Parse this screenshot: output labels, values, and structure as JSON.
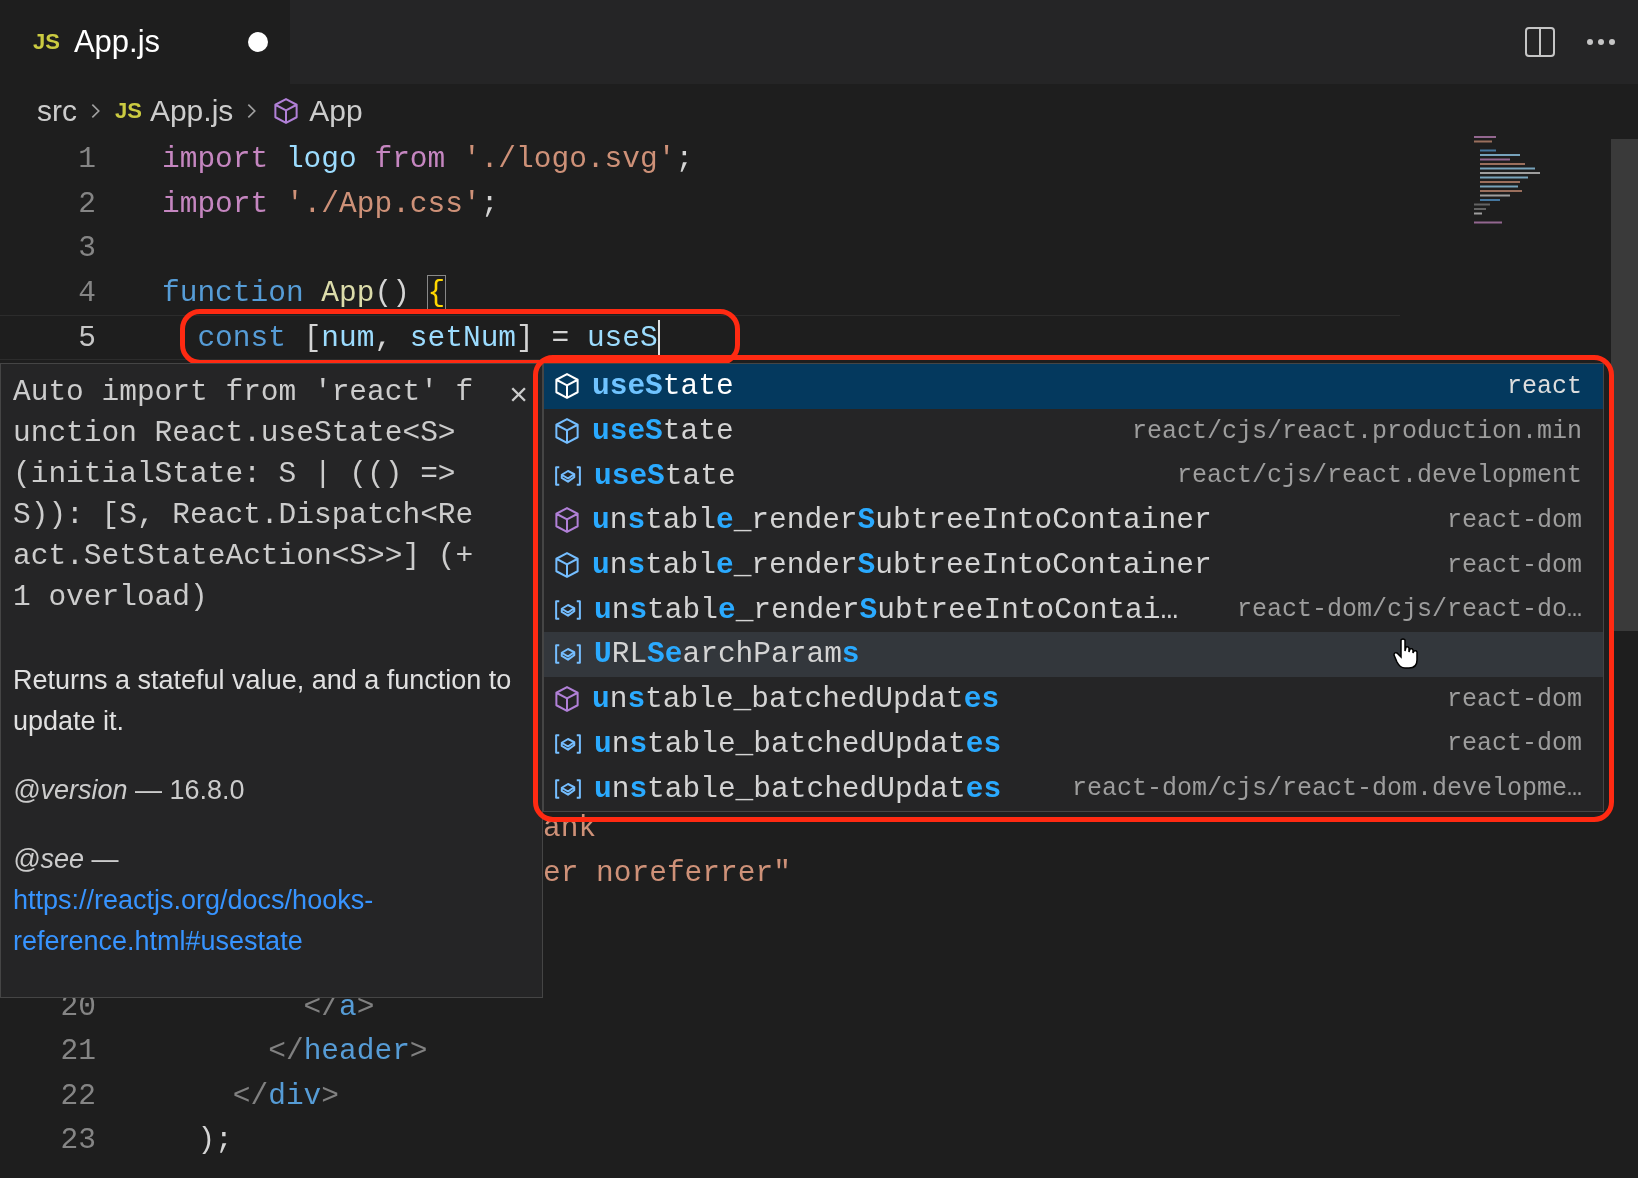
{
  "tab": {
    "icon_label": "JS",
    "title": "App.js",
    "modified": true
  },
  "breadcrumb": [
    {
      "kind": "folder",
      "label": "src"
    },
    {
      "kind": "file",
      "icon_label": "JS",
      "label": "App.js"
    },
    {
      "kind": "symbol",
      "label": "App"
    }
  ],
  "code_top": [
    {
      "number": "1",
      "current": false,
      "caret": false,
      "tokens": [
        {
          "text": "import ",
          "kind": "keyword"
        },
        {
          "text": "logo ",
          "kind": "variable"
        },
        {
          "text": "from ",
          "kind": "keyword"
        },
        {
          "text": "'./logo.svg'",
          "kind": "string"
        },
        {
          "text": ";",
          "kind": "plain"
        }
      ]
    },
    {
      "number": "2",
      "current": false,
      "caret": false,
      "tokens": [
        {
          "text": "import ",
          "kind": "keyword"
        },
        {
          "text": "'./App.css'",
          "kind": "string"
        },
        {
          "text": ";",
          "kind": "plain"
        }
      ]
    },
    {
      "number": "3",
      "current": false,
      "caret": false
    },
    {
      "number": "4",
      "current": false,
      "caret": false,
      "tokens": [
        {
          "text": "function ",
          "kind": "storage"
        },
        {
          "text": "App",
          "kind": "func"
        },
        {
          "text": "() ",
          "kind": "plain"
        },
        {
          "text": "{",
          "kind": "bracket_match"
        }
      ]
    },
    {
      "number": "5",
      "current": true,
      "caret": true,
      "tokens": [
        {
          "text": "  const ",
          "kind": "storage"
        },
        {
          "text": "[",
          "kind": "plain"
        },
        {
          "text": "num",
          "kind": "variable"
        },
        {
          "text": ", ",
          "kind": "plain"
        },
        {
          "text": "setNum",
          "kind": "variable"
        },
        {
          "text": "] = ",
          "kind": "plain"
        },
        {
          "text": "useS",
          "kind": "variable"
        }
      ]
    }
  ],
  "code_fragments": [
    {
      "text": "ank",
      "kind": "string"
    },
    {
      "text": "er noreferrer\"",
      "kind": "string"
    }
  ],
  "code_bottom": [
    {
      "number": "20",
      "current": false,
      "caret": false,
      "tokens": [
        {
          "text": "        </",
          "kind": "punct"
        },
        {
          "text": "a",
          "kind": "tag"
        },
        {
          "text": ">",
          "kind": "punct"
        }
      ]
    },
    {
      "number": "21",
      "current": false,
      "caret": false,
      "tokens": [
        {
          "text": "      </",
          "kind": "punct"
        },
        {
          "text": "header",
          "kind": "tag"
        },
        {
          "text": ">",
          "kind": "punct"
        }
      ]
    },
    {
      "number": "22",
      "current": false,
      "caret": false,
      "tokens": [
        {
          "text": "    </",
          "kind": "punct"
        },
        {
          "text": "div",
          "kind": "tag"
        },
        {
          "text": ">",
          "kind": "punct"
        }
      ]
    },
    {
      "number": "23",
      "current": false,
      "caret": false,
      "tokens": [
        {
          "text": "  );",
          "kind": "plain"
        }
      ]
    }
  ],
  "hover": {
    "signature_lines": [
      "Auto import from 'react' f",
      "unction React.useState<S>",
      "(initialState: S | (() =>",
      "S)): [S, React.Dispatch<Re",
      "act.SetStateAction<S>>] (+",
      "1 overload)"
    ],
    "description": "Returns a stateful value, and a function to update it.",
    "version": "*@version* — 16.8.0",
    "see": "*@see* —",
    "link": "https://reactjs.org/docs/hooks-reference.html#usestate",
    "close_label": "×"
  },
  "suggestions": [
    {
      "kind": "module",
      "color": "#ffffff",
      "label": "**useS**tate",
      "detail": "react",
      "selected": true,
      "hovered": false
    },
    {
      "kind": "module",
      "color": "#75beff",
      "label": "**useS**tate",
      "detail": "react/cjs/react.production.min",
      "selected": false,
      "hovered": false
    },
    {
      "kind": "variable",
      "color": "#75beff",
      "label": "**useS**tate",
      "detail": "react/cjs/react.development",
      "selected": false,
      "hovered": false
    },
    {
      "kind": "module",
      "color": "#b180d7",
      "label": "**u**n**s**tabl**e**_render**S**ubtreeIntoContainer",
      "detail": "react-dom",
      "selected": false,
      "hovered": false
    },
    {
      "kind": "module",
      "color": "#75beff",
      "label": "**u**n**s**tabl**e**_render**S**ubtreeIntoContainer",
      "detail": "react-dom",
      "selected": false,
      "hovered": false
    },
    {
      "kind": "variable",
      "color": "#75beff",
      "label": "**u**n**s**tabl**e**_render**S**ubtreeIntoContai…",
      "detail": "react-dom/cjs/react-do…",
      "selected": false,
      "hovered": false
    },
    {
      "kind": "variable",
      "color": "#75beff",
      "label": "**U**RL**Se**archParam**s**",
      "selected": false,
      "hovered": true
    },
    {
      "kind": "module",
      "color": "#b180d7",
      "label": "**u**n**s**table_batchedUpdat**es**",
      "detail": "react-dom",
      "selected": false,
      "hovered": false
    },
    {
      "kind": "variable",
      "color": "#75beff",
      "label": "**u**n**s**table_batchedUpdat**es**",
      "detail": "react-dom",
      "selected": false,
      "hovered": false
    },
    {
      "kind": "variable",
      "color": "#75beff",
      "label": "**u**n**s**table_batchedUpdat**es**",
      "detail": "react-dom/cjs/react-dom.developme…",
      "selected": false,
      "hovered": false
    }
  ]
}
